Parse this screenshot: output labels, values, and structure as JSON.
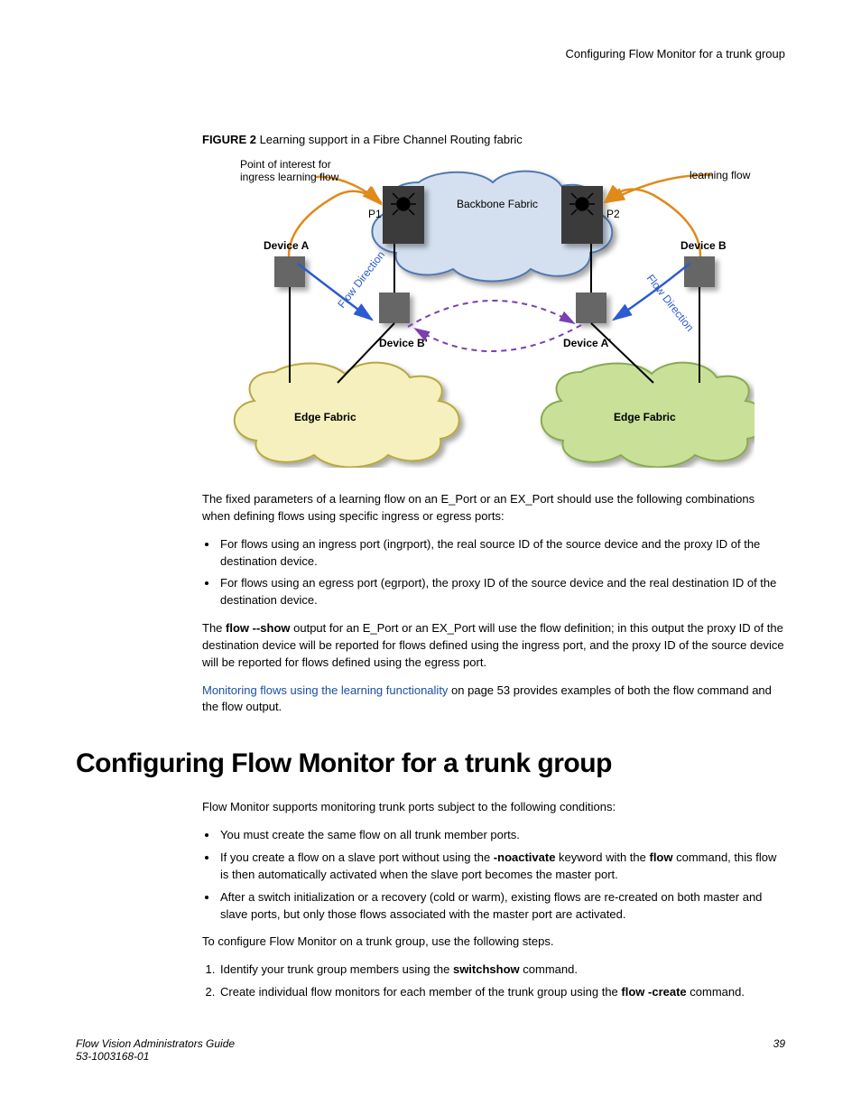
{
  "header": {
    "running_title": "Configuring Flow Monitor for a trunk group"
  },
  "figure": {
    "label_bold": "FIGURE 2",
    "label_rest": " Learning support in a Fibre Channel Routing fabric",
    "labels": {
      "poi": "Point of interest for\ningress learning flow",
      "learning_flow": "learning flow",
      "backbone": "Backbone Fabric",
      "p1": "P1",
      "p2": "P2",
      "devA": "Device A",
      "devB": "Device B",
      "devAprime": "Device A'",
      "devBprime": "Device B'",
      "flowdir1": "Flow Direction",
      "flowdir2": "Flow Direction",
      "edge1": "Edge Fabric",
      "edge2": "Edge Fabric"
    }
  },
  "body": {
    "p1": "The fixed parameters of a learning flow on an E_Port or an EX_Port should use the following combinations when defining flows using specific ingress or egress ports:",
    "bul1": "For flows using an ingress port (ingrport), the real source ID of the source device and the proxy ID of the destination device.",
    "bul2": "For flows using an egress port (egrport), the proxy ID of the source device and the real destination ID of the destination device.",
    "p2a": "The ",
    "p2b": "flow --show",
    "p2c": " output for an E_Port or an EX_Port will use the flow definition; in this output the proxy ID of the destination device will be reported for flows defined using the ingress port, and the proxy ID of the source device will be reported for flows defined using the egress port.",
    "link_text": "Monitoring flows using the learning functionality",
    "p3_rest": " on page 53 provides examples of both the flow command and the flow output."
  },
  "section": {
    "title": "Configuring Flow Monitor for a trunk group",
    "intro": "Flow Monitor supports monitoring trunk ports subject to the following conditions:",
    "b1": "You must create the same flow on all trunk member ports.",
    "b2a": "If you create a flow on a slave port without using the ",
    "b2b": "-noactivate",
    "b2c": " keyword with the ",
    "b2d": "flow",
    "b2e": " command, this flow is then automatically activated when the slave port becomes the master port.",
    "b3": "After a switch initialization or a recovery (cold or warm), existing flows are re-created on both master and slave ports, but only those flows associated with the master port are activated.",
    "steps_intro": "To configure Flow Monitor on a trunk group, use the following steps.",
    "s1a": "Identify your trunk group members using the ",
    "s1b": "switchshow",
    "s1c": " command.",
    "s2a": "Create individual flow monitors for each member of the trunk group using the ",
    "s2b": "flow -create",
    "s2c": " command."
  },
  "footer": {
    "title": "Flow Vision Administrators Guide",
    "docnum": "53-1003168-01",
    "page": "39"
  }
}
